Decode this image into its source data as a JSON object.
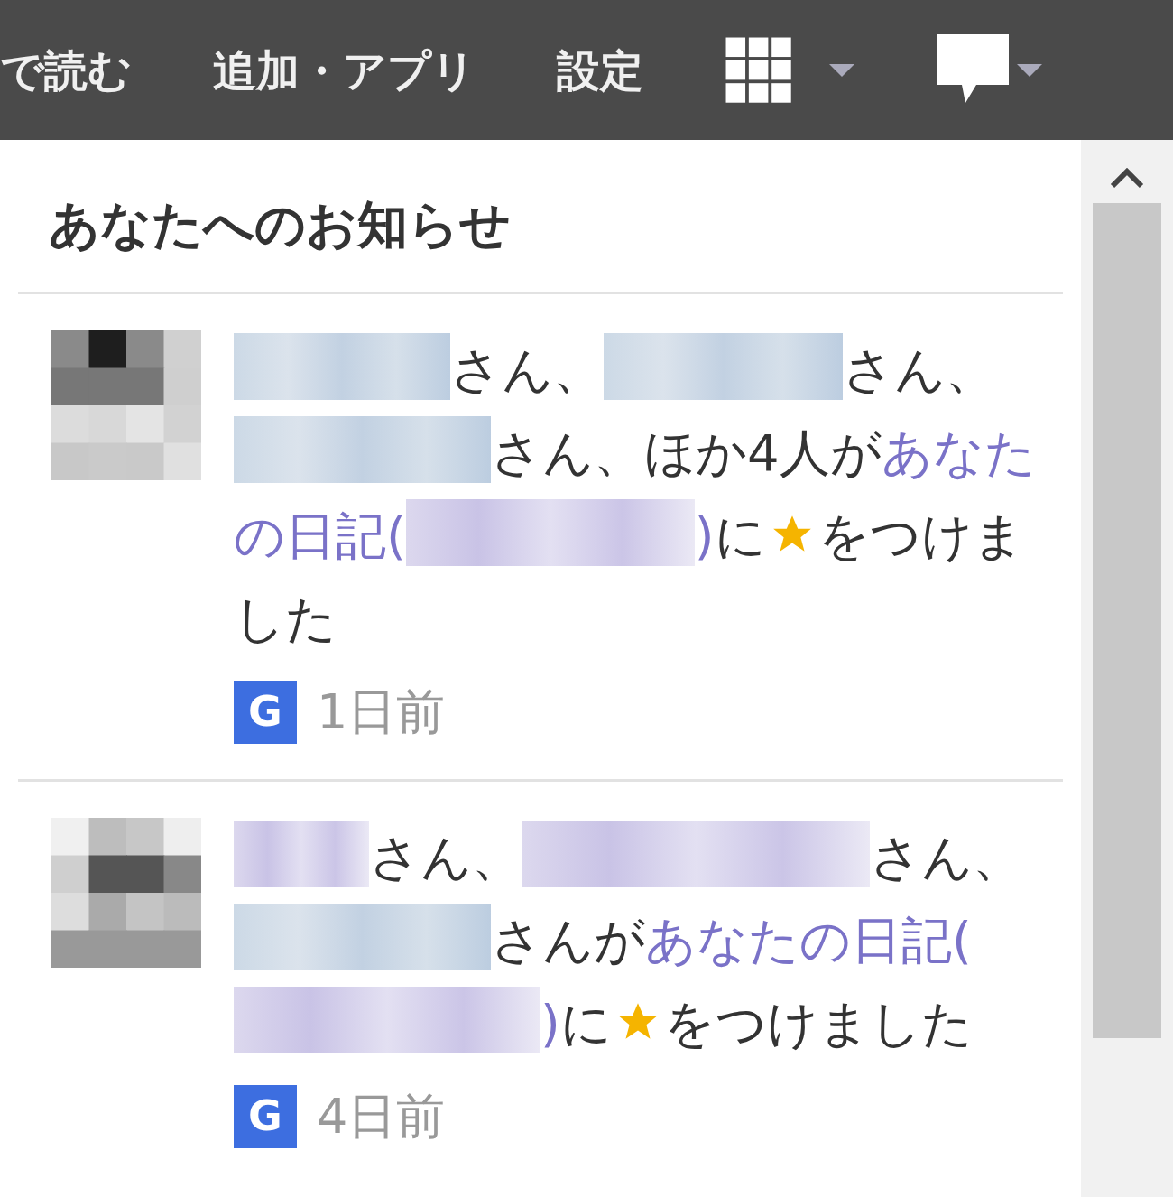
{
  "top_bar": {
    "items": [
      {
        "kind": "text",
        "label": "で読む"
      },
      {
        "kind": "text",
        "label": "追加・アプリ"
      },
      {
        "kind": "text",
        "label": "設定"
      },
      {
        "kind": "apps"
      },
      {
        "kind": "feedback"
      }
    ]
  },
  "panel": {
    "title": "あなたへのお知らせ",
    "notifications": [
      {
        "avatar": {
          "kind": "picture"
        },
        "segments": [
          {
            "kind": "redacted",
            "link": false
          },
          {
            "kind": "text",
            "text": "さん、",
            "link": false
          },
          {
            "kind": "redacted",
            "link": false
          },
          {
            "kind": "text",
            "text": "さん、",
            "link": false
          },
          {
            "kind": "redacted",
            "link": false
          },
          {
            "kind": "text",
            "text": "さん、ほか4人が",
            "link": false
          },
          {
            "kind": "text",
            "text": "あなたの日記(",
            "link": true
          },
          {
            "kind": "redacted",
            "link": true
          },
          {
            "kind": "text",
            "text": ")",
            "link": true
          },
          {
            "kind": "text",
            "text": "に",
            "link": false
          },
          {
            "kind": "star"
          },
          {
            "kind": "text",
            "text": "をつけました",
            "link": false
          }
        ],
        "badge": "G",
        "time": "1日前"
      },
      {
        "avatar": {
          "kind": "picture"
        },
        "segments": [
          {
            "kind": "redacted",
            "link": true
          },
          {
            "kind": "text",
            "text": "さん、",
            "link": false
          },
          {
            "kind": "redacted",
            "link": true
          },
          {
            "kind": "text",
            "text": "さん、",
            "link": false
          },
          {
            "kind": "redacted",
            "link": false
          },
          {
            "kind": "text",
            "text": "さんが",
            "link": false
          },
          {
            "kind": "text",
            "text": "あなたの日記",
            "link": true
          },
          {
            "kind": "text",
            "text": "(",
            "link": true
          },
          {
            "kind": "redacted",
            "link": true
          },
          {
            "kind": "text",
            "text": ")",
            "link": true
          },
          {
            "kind": "text",
            "text": "に",
            "link": false
          },
          {
            "kind": "star"
          },
          {
            "kind": "text",
            "text": "をつけました",
            "link": false
          }
        ],
        "badge": "G",
        "time": "4日前"
      }
    ]
  }
}
